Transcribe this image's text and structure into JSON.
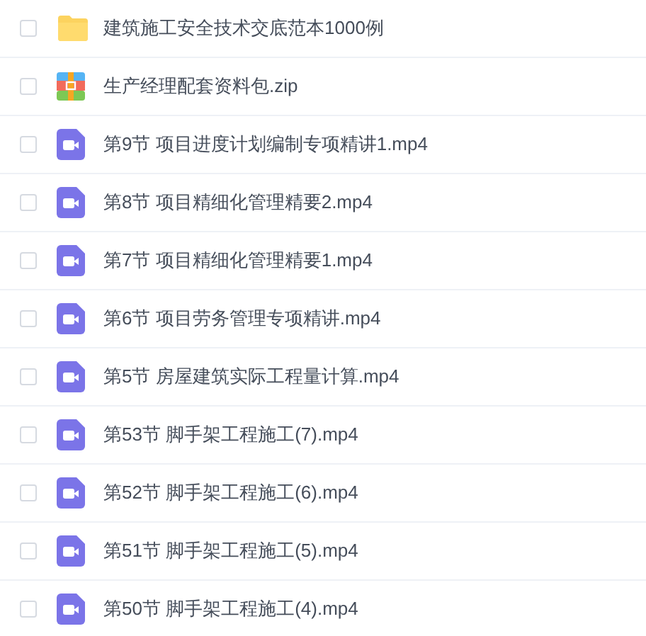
{
  "files": [
    {
      "kind": "folder",
      "name": "建筑施工安全技术交底范本1000例",
      "checked": false
    },
    {
      "kind": "zip",
      "name": "生产经理配套资料包.zip",
      "checked": false
    },
    {
      "kind": "video",
      "name": "第9节 项目进度计划编制专项精讲1.mp4",
      "checked": false
    },
    {
      "kind": "video",
      "name": "第8节 项目精细化管理精要2.mp4",
      "checked": false
    },
    {
      "kind": "video",
      "name": "第7节 项目精细化管理精要1.mp4",
      "checked": false
    },
    {
      "kind": "video",
      "name": "第6节 项目劳务管理专项精讲.mp4",
      "checked": false
    },
    {
      "kind": "video",
      "name": "第5节 房屋建筑实际工程量计算.mp4",
      "checked": false
    },
    {
      "kind": "video",
      "name": "第53节 脚手架工程施工(7).mp4",
      "checked": false
    },
    {
      "kind": "video",
      "name": "第52节 脚手架工程施工(6).mp4",
      "checked": false
    },
    {
      "kind": "video",
      "name": "第51节 脚手架工程施工(5).mp4",
      "checked": false
    },
    {
      "kind": "video",
      "name": "第50节 脚手架工程施工(4).mp4",
      "checked": false
    }
  ]
}
